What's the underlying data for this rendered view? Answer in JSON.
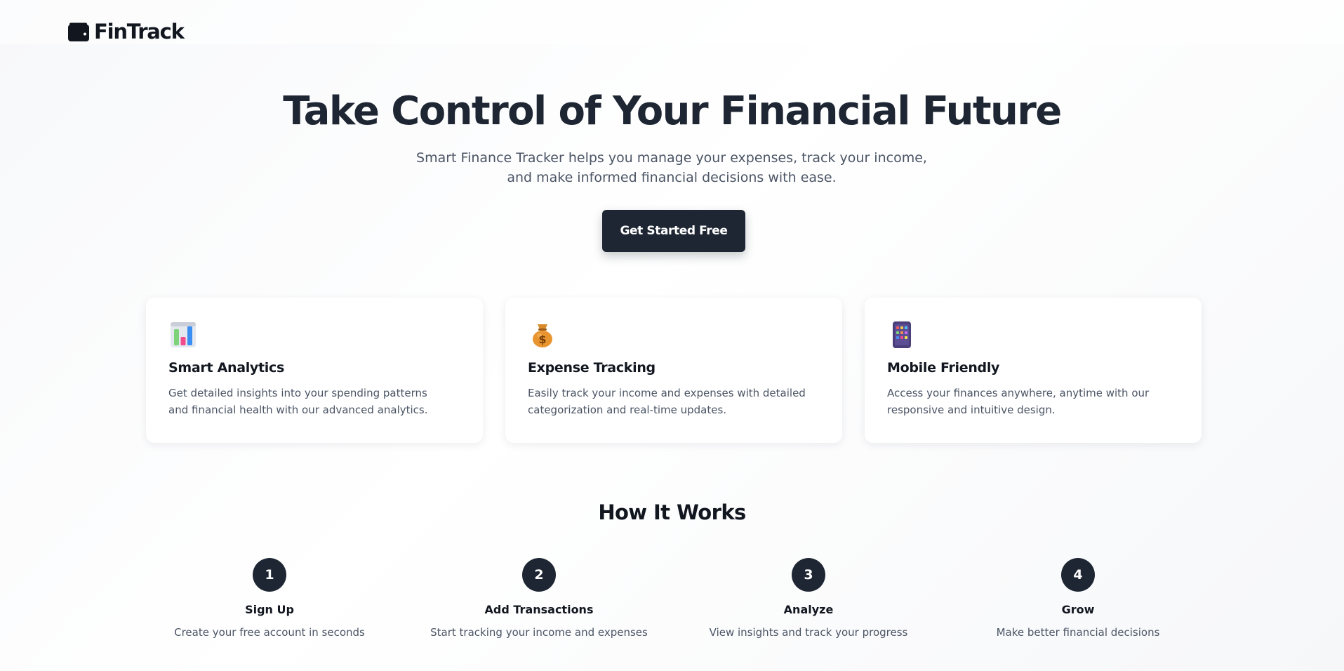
{
  "brand": {
    "name": "FinTrack",
    "icon": "wallet-icon"
  },
  "hero": {
    "title": "Take Control of Your Financial Future",
    "subtitle_line1": "Smart Finance Tracker helps you manage your expenses, track your income,",
    "subtitle_line2": "and make informed financial decisions with ease.",
    "cta_label": "Get Started Free"
  },
  "features": [
    {
      "icon": "bar-chart-icon",
      "title": "Smart Analytics",
      "text": "Get detailed insights into your spending patterns and financial health with our advanced analytics."
    },
    {
      "icon": "money-bag-icon",
      "title": "Expense Tracking",
      "text": "Easily track your income and expenses with detailed categorization and real-time updates."
    },
    {
      "icon": "mobile-phone-icon",
      "title": "Mobile Friendly",
      "text": "Access your finances anywhere, anytime with our responsive and intuitive design."
    }
  ],
  "how_it_works": {
    "title": "How It Works",
    "steps": [
      {
        "number": "1",
        "title": "Sign Up",
        "text": "Create your free account in seconds"
      },
      {
        "number": "2",
        "title": "Add Transactions",
        "text": "Start tracking your income and expenses"
      },
      {
        "number": "3",
        "title": "Analyze",
        "text": "View insights and track your progress"
      },
      {
        "number": "4",
        "title": "Grow",
        "text": "Make better financial decisions"
      }
    ]
  },
  "colors": {
    "primary": "#1e2633",
    "text_muted": "#4b5565",
    "card_bg": "#ffffff"
  }
}
